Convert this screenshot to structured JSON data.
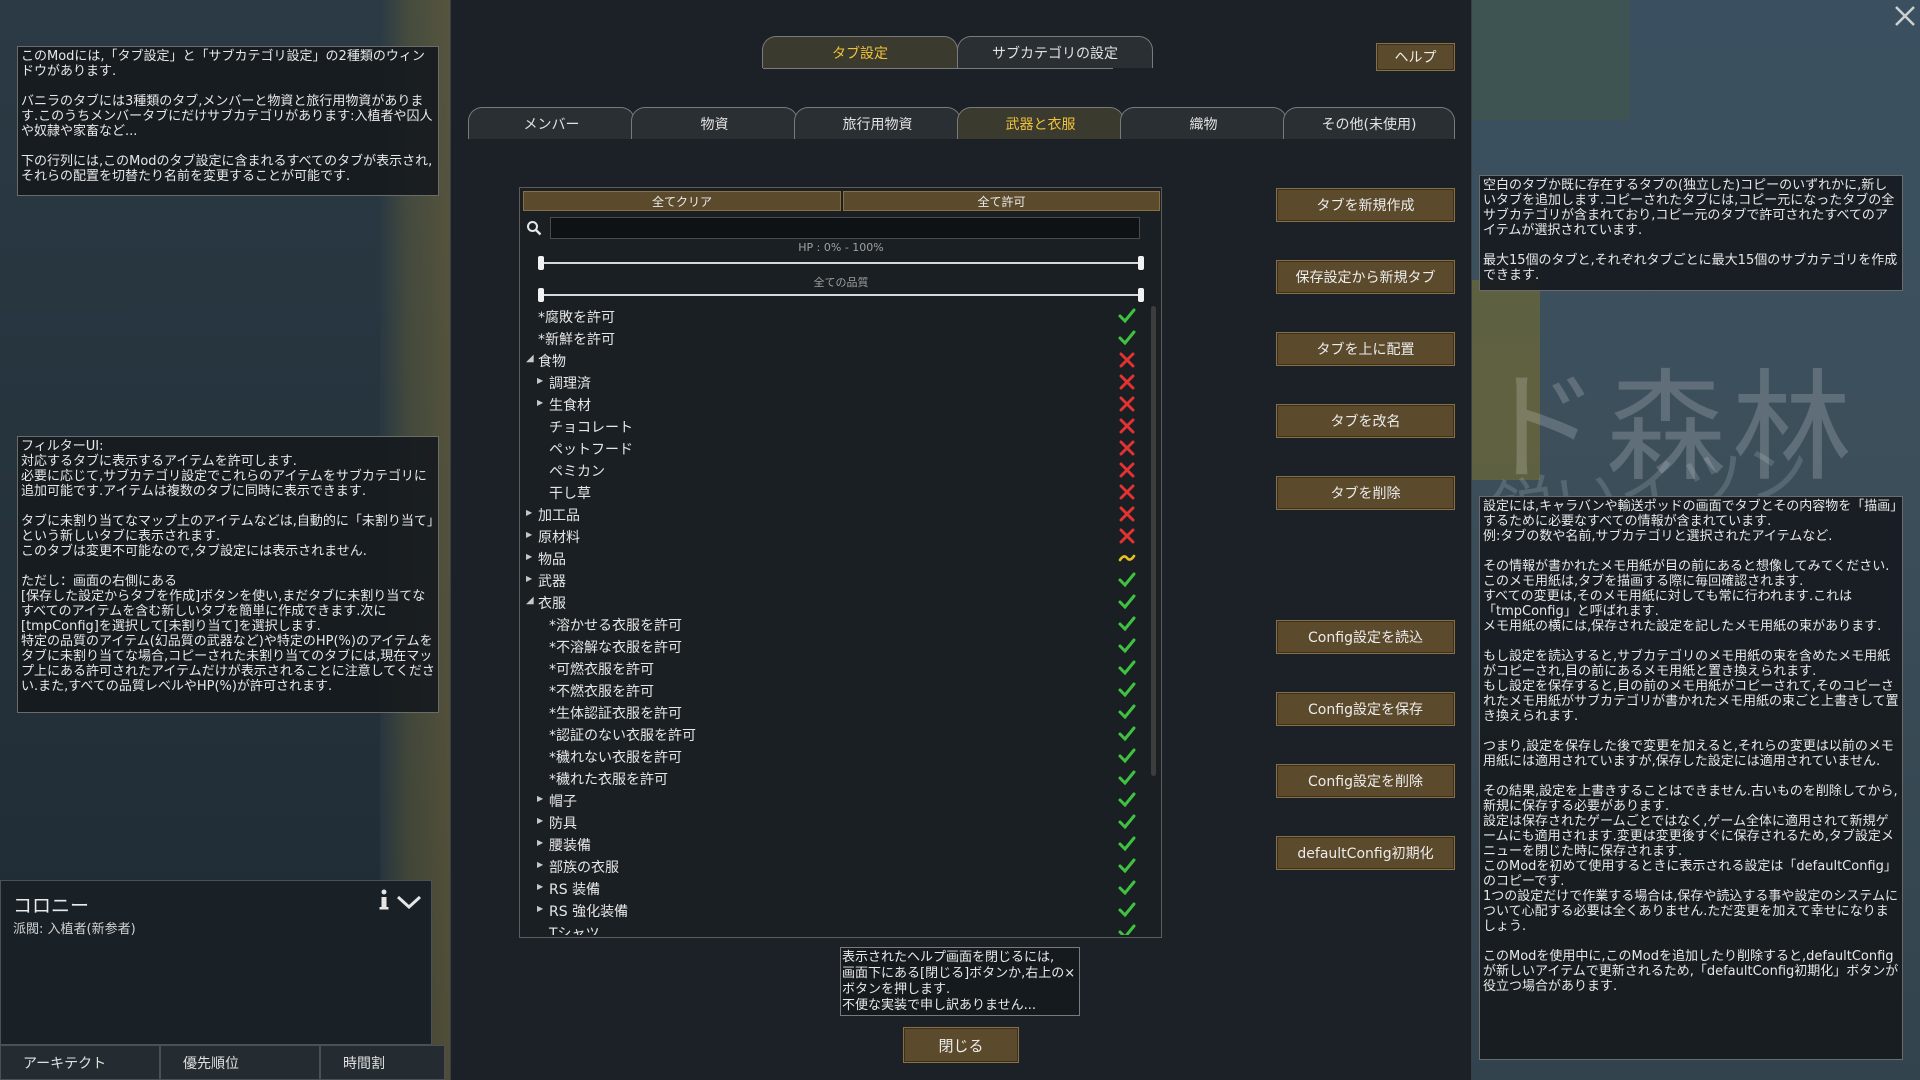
{
  "left_help": {
    "box1": "このModには,「タブ設定」と「サブカテゴリ設定」の2種類のウィンドウがあります.\n\nバニラのタブには3種類のタブ,メンバーと物資と旅行用物資があります.このうちメンバータブにだけサブカテゴリがあります:入植者や囚人や奴隷や家畜など...\n\n下の行列には,このModのタブ設定に含まれるすべてのタブが表示され,それらの配置を切替たり名前を変更することが可能です.",
    "box2": "フィルターUI:\n対応するタブに表示するアイテムを許可します.\n必要に応じて,サブカテゴリ設定でこれらのアイテムをサブカテゴリに追加可能です.アイテムは複数のタブに同時に表示できます.\n\nタブに未割り当てなマップ上のアイテムなどは,自動的に「未割り当て」という新しいタブに表示されます.\nこのタブは変更不可能なので,タブ設定には表示されません.\n\nただし：画面の右側にある\n[保存した設定からタブを作成]ボタンを使い,まだタブに未割り当てなすべてのアイテムを含む新しいタブを簡単に作成できます.次に[tmpConfig]を選択して[未割り当て]を選択します.\n特定の品質のアイテム(幻品質の武器など)や特定のHP(%)のアイテムをタブに未割り当てな場合,コピーされた未割り当てのタブには,現在マップ上にある許可されたアイテムだけが表示されることに注意してください.また,すべての品質レベルやHP(%)が許可されます."
  },
  "right_help": {
    "box1": "空白のタブか既に存在するタブの(独立した)コピーのいずれかに,新しいタブを追加します.コピーされたタブには,コピー元になったタブの全サブカテゴリが含まれており,コピー元のタブで許可されたすべてのアイテムが選択されています.\n\n最大15個のタブと,それぞれタブごとに最大15個のサブカテゴリを作成できます.",
    "box2": "設定には,キャラバンや輸送ポッドの画面でタブとその内容物を「描画」するために必要なすべての情報が含まれています.\n例:タブの数や名前,サブカテゴリと選択されたアイテムなど.\n\nその情報が書かれたメモ用紙が目の前にあると想像してみてください.このメモ用紙は,タブを描画する際に毎回確認されます.\nすべての変更は,そのメモ用紙に対しても常に行われます.これは「tmpConfig」と呼ばれます.\nメモ用紙の横には,保存された設定を記したメモ用紙の束があります.\n\nもし設定を読込すると,サブカテゴリのメモ用紙の束を含めたメモ用紙がコピーされ,目の前にあるメモ用紙と置き換えられます.\nもし設定を保存すると,目の前のメモ用紙がコピーされて,そのコピーされたメモ用紙がサブカテゴリが書かれたメモ用紙の束ごと上書きして置き換えられます.\n\nつまり,設定を保存した後で変更を加えると,それらの変更は以前のメモ用紙には適用されていますが,保存した設定には適用されていません.\n\nその結果,設定を上書きすることはできません.古いものを削除してから,新規に保存する必要があります.\n設定は保存されたゲームごとではなく,ゲーム全体に適用されて新規ゲームにも適用されます.変更は変更後すぐに保存されるため,タブ設定メニューを閉じた時に保存されます.\nこのModを初めて使用するときに表示される設定は「defaultConfig」のコピーです.\n1つの設定だけで作業する場合は,保存や読込する事や設定のシステムについて心配する必要は全くありません.ただ変更を加えて幸せになりましょう.\n\nこのModを使用中に,このModを追加したり削除すると,defaultConfigが新しいアイテムで更新されるため,「defaultConfig初期化」ボタンが役立つ場合があります."
  },
  "map": {
    "label_big": "ド森林",
    "label_small": "鋭いイツン"
  },
  "top_tabs": [
    {
      "label": "タブ設定",
      "active": true
    },
    {
      "label": "サブカテゴリの設定",
      "active": false
    }
  ],
  "help_button": "ヘルプ",
  "category_tabs": [
    {
      "label": "メンバー",
      "active": false
    },
    {
      "label": "物資",
      "active": false
    },
    {
      "label": "旅行用物資",
      "active": false
    },
    {
      "label": "武器と衣服",
      "active": true
    },
    {
      "label": "織物",
      "active": false
    },
    {
      "label": "その他(未使用)",
      "active": false
    }
  ],
  "filter": {
    "clear_all": "全てクリア",
    "allow_all": "全て許可",
    "search_value": "",
    "hp_label": "HP : 0% - 100%",
    "hp_range": [
      0,
      100
    ],
    "quality_label": "全ての品質",
    "items": [
      {
        "label": "*腐敗を許可",
        "indent": 0,
        "arrow": "",
        "state": "check"
      },
      {
        "label": "*新鮮を許可",
        "indent": 0,
        "arrow": "",
        "state": "check"
      },
      {
        "label": "食物",
        "indent": 0,
        "arrow": "down",
        "state": "cross"
      },
      {
        "label": "調理済",
        "indent": 1,
        "arrow": "right",
        "state": "cross"
      },
      {
        "label": "生食材",
        "indent": 1,
        "arrow": "right",
        "state": "cross"
      },
      {
        "label": "チョコレート",
        "indent": 1,
        "arrow": "",
        "state": "cross"
      },
      {
        "label": "ペットフード",
        "indent": 1,
        "arrow": "",
        "state": "cross"
      },
      {
        "label": "ペミカン",
        "indent": 1,
        "arrow": "",
        "state": "cross"
      },
      {
        "label": "干し草",
        "indent": 1,
        "arrow": "",
        "state": "cross"
      },
      {
        "label": "加工品",
        "indent": 0,
        "arrow": "right",
        "state": "cross"
      },
      {
        "label": "原材料",
        "indent": 0,
        "arrow": "right",
        "state": "cross"
      },
      {
        "label": "物品",
        "indent": 0,
        "arrow": "right",
        "state": "partial"
      },
      {
        "label": "武器",
        "indent": 0,
        "arrow": "right",
        "state": "check"
      },
      {
        "label": "衣服",
        "indent": 0,
        "arrow": "down",
        "state": "check"
      },
      {
        "label": "*溶かせる衣服を許可",
        "indent": 1,
        "arrow": "",
        "state": "check"
      },
      {
        "label": "*不溶解な衣服を許可",
        "indent": 1,
        "arrow": "",
        "state": "check"
      },
      {
        "label": "*可燃衣服を許可",
        "indent": 1,
        "arrow": "",
        "state": "check"
      },
      {
        "label": "*不燃衣服を許可",
        "indent": 1,
        "arrow": "",
        "state": "check"
      },
      {
        "label": "*生体認証衣服を許可",
        "indent": 1,
        "arrow": "",
        "state": "check"
      },
      {
        "label": "*認証のない衣服を許可",
        "indent": 1,
        "arrow": "",
        "state": "check"
      },
      {
        "label": "*穢れない衣服を許可",
        "indent": 1,
        "arrow": "",
        "state": "check"
      },
      {
        "label": "*穢れた衣服を許可",
        "indent": 1,
        "arrow": "",
        "state": "check"
      },
      {
        "label": "帽子",
        "indent": 1,
        "arrow": "right",
        "state": "check"
      },
      {
        "label": "防具",
        "indent": 1,
        "arrow": "right",
        "state": "check"
      },
      {
        "label": "腰装備",
        "indent": 1,
        "arrow": "right",
        "state": "check"
      },
      {
        "label": "部族の衣服",
        "indent": 1,
        "arrow": "right",
        "state": "check"
      },
      {
        "label": "RS 装備",
        "indent": 1,
        "arrow": "right",
        "state": "check"
      },
      {
        "label": "RS 強化装備",
        "indent": 1,
        "arrow": "right",
        "state": "check"
      },
      {
        "label": "Tシャツ",
        "indent": 1,
        "arrow": "",
        "state": "check"
      }
    ]
  },
  "side_buttons": [
    "タブを新規作成",
    "保存設定から新規タブ",
    "タブを上に配置",
    "タブを改名",
    "タブを削除",
    "Config設定を読込",
    "Config設定を保存",
    "Config設定を削除",
    "defaultConfig初期化"
  ],
  "note": "表示されたヘルプ画面を閉じるには,\n画面下にある[閉じる]ボタンか,右上の×ボタンを押します.\n不便な実装で申し訳ありません...",
  "close_button": "閉じる",
  "colony": {
    "title": "コロニー",
    "faction": "派閥: 入植者(新参者)"
  },
  "bottom_tabs": [
    "アーキテクト",
    "優先順位",
    "時間割"
  ],
  "colors": {
    "accent": "#f0c23a",
    "button": "#5b4a2c",
    "check": "#3fc23f",
    "cross": "#e23232",
    "partial": "#e8c020"
  }
}
